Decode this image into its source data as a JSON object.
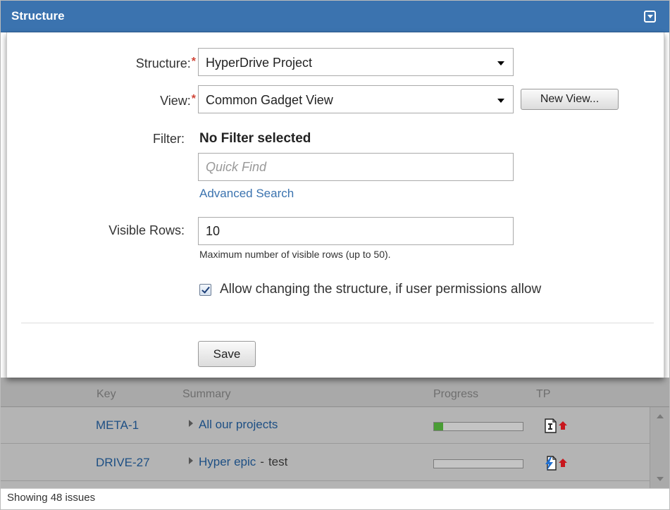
{
  "gadget": {
    "title": "Structure"
  },
  "form": {
    "structure_label": "Structure:",
    "structure_value": "HyperDrive Project",
    "view_label": "View:",
    "view_value": "Common Gadget View",
    "new_view_button": "New View...",
    "required_marker": "*",
    "filter_label": "Filter:",
    "filter_value": "No Filter selected",
    "quick_find_placeholder": "Quick Find",
    "advanced_search_link": "Advanced Search",
    "visible_rows_label": "Visible Rows:",
    "visible_rows_value": "10",
    "visible_rows_hint": "Maximum number of visible rows (up to 50).",
    "allow_changing_label": "Allow changing the structure, if user permissions allow",
    "allow_changing_checked": true,
    "save_button": "Save"
  },
  "grid": {
    "columns": [
      "Key",
      "Summary",
      "Progress",
      "TP"
    ],
    "rows": [
      {
        "key": "META-1",
        "summary": "All our projects",
        "extra": "",
        "progress": 0.1,
        "type_icon": "task-icon",
        "priority_icon": "priority-up-icon"
      },
      {
        "key": "DRIVE-27",
        "summary": "Hyper epic",
        "separator": "-",
        "extra": "test",
        "progress": 0,
        "type_icon": "epic-icon",
        "priority_icon": "priority-up-icon"
      }
    ]
  },
  "footer": {
    "status_text": "Showing 48 issues"
  },
  "colors": {
    "header": "#3b73af",
    "required": "#d04437",
    "link": "#3b73af",
    "progress": "#4a9d35"
  }
}
